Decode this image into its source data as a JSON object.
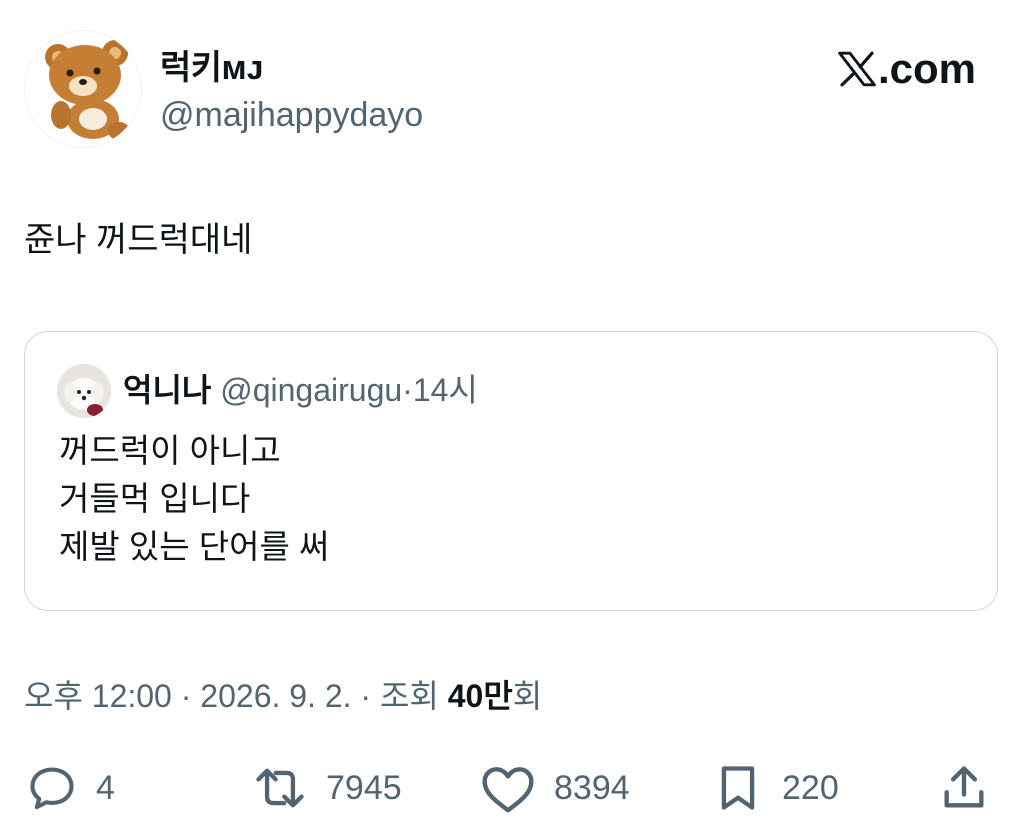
{
  "author": {
    "display_name": "럭키ᴍᴊ",
    "handle": "@majihappydayo",
    "avatar_icon": "bear-avatar-icon"
  },
  "brand": {
    "logo_text": ".com",
    "logo_icon": "x-logo-icon"
  },
  "tweet": {
    "text": "쥰나 꺼드럭대네"
  },
  "quote": {
    "name": "억니나",
    "handle": "@qingairugu",
    "separator": "·",
    "time": "14시",
    "avatar_icon": "dog-avatar-icon",
    "lines": [
      "꺼드럭이 아니고",
      "거들먹 입니다",
      "제발 있는 단어를 써"
    ]
  },
  "meta": {
    "time": "오후 12:00",
    "sep1": "·",
    "date": "2026. 9. 2.",
    "sep2": "·",
    "views_label": "조회",
    "views_value": "40만",
    "views_suffix": "회"
  },
  "actions": {
    "reply": {
      "icon": "reply-icon",
      "count": "4"
    },
    "retweet": {
      "icon": "retweet-icon",
      "count": "7945"
    },
    "like": {
      "icon": "heart-icon",
      "count": "8394"
    },
    "bookmark": {
      "icon": "bookmark-icon",
      "count": "220"
    },
    "share": {
      "icon": "share-icon"
    }
  },
  "colors": {
    "text": "#0f1419",
    "muted": "#536471",
    "border": "#cfd9de"
  }
}
